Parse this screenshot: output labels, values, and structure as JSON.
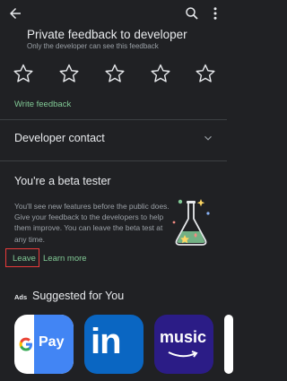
{
  "feedback": {
    "title": "Private feedback to developer",
    "subtitle": "Only the developer can see this feedback",
    "write_label": "Write feedback"
  },
  "developer_contact": {
    "label": "Developer contact"
  },
  "beta": {
    "title": "You're a beta tester",
    "description": "You'll see new features before the public does. Give your feedback to the developers to help them improve. You can leave the beta test at any time.",
    "leave_label": "Leave",
    "learn_label": "Learn more"
  },
  "suggested": {
    "ads_tag": "Ads",
    "title": "Suggested for You",
    "apps": [
      {
        "label": "Pay"
      },
      {
        "label": "in"
      },
      {
        "label": "music"
      }
    ]
  },
  "icons": {
    "back": "arrow-left-icon",
    "search": "search-icon",
    "more": "more-vert-icon",
    "star": "star-outline-icon",
    "chevron": "chevron-down-icon",
    "flask": "beta-flask-illustration"
  },
  "colors": {
    "background": "#202124",
    "accent": "#81c995",
    "highlight_box": "#ea3a3a",
    "linkedin": "#0a66c2",
    "music": "#2b1c86",
    "gpay_blue": "#4285f4"
  }
}
